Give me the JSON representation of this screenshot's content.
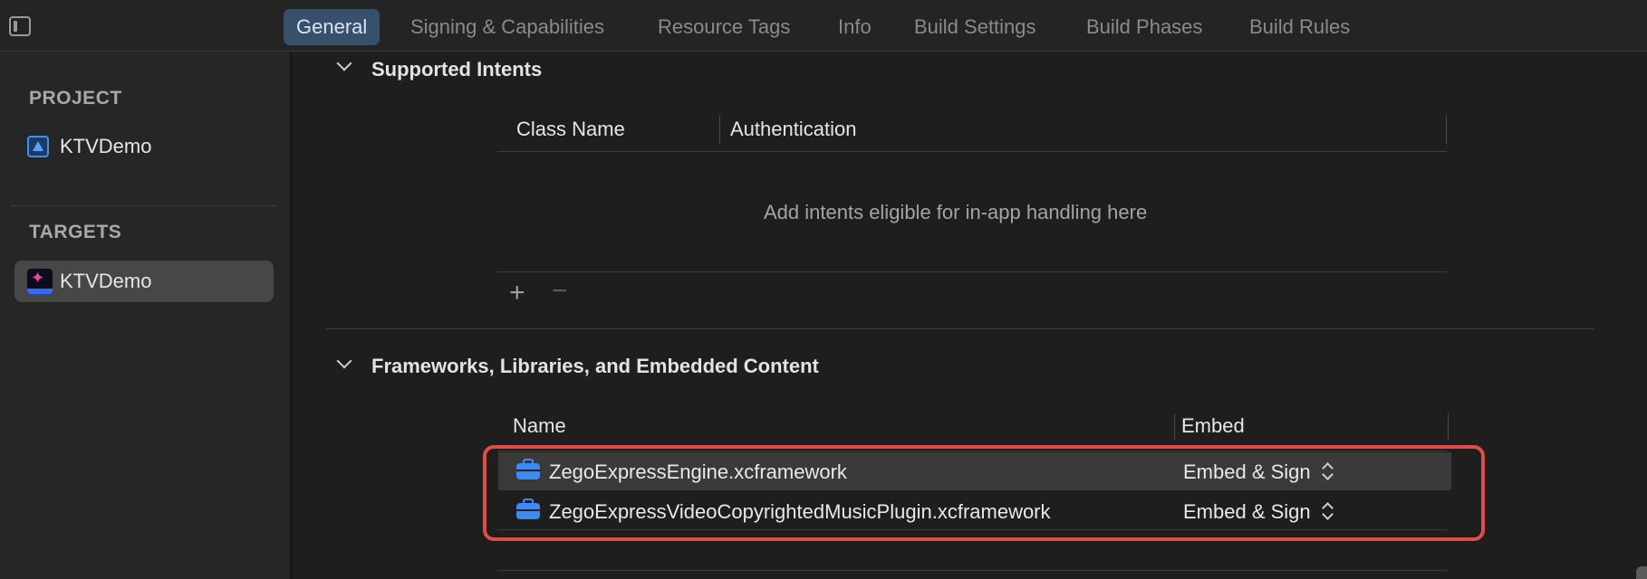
{
  "tabs": [
    {
      "label": "General",
      "active": true
    },
    {
      "label": "Signing & Capabilities",
      "active": false
    },
    {
      "label": "Resource Tags",
      "active": false
    },
    {
      "label": "Info",
      "active": false
    },
    {
      "label": "Build Settings",
      "active": false
    },
    {
      "label": "Build Phases",
      "active": false
    },
    {
      "label": "Build Rules",
      "active": false
    }
  ],
  "sidebar": {
    "project_heading": "PROJECT",
    "project_item": "KTVDemo",
    "targets_heading": "TARGETS",
    "target_item": "KTVDemo"
  },
  "supported_intents": {
    "title": "Supported Intents",
    "columns": [
      "Class Name",
      "Authentication"
    ],
    "placeholder": "Add intents eligible for in-app handling here",
    "add_label": "+",
    "remove_label": "−"
  },
  "frameworks": {
    "title": "Frameworks, Libraries, and Embedded Content",
    "columns": [
      "Name",
      "Embed"
    ],
    "rows": [
      {
        "name": "ZegoExpressEngine.xcframework",
        "embed": "Embed & Sign"
      },
      {
        "name": "ZegoExpressVideoCopyrightedMusicPlugin.xcframework",
        "embed": "Embed & Sign"
      }
    ]
  },
  "colors": {
    "accent_tab": "#39506c",
    "highlight_border": "#e34a4a",
    "framework_icon": "#3d8bf2"
  }
}
